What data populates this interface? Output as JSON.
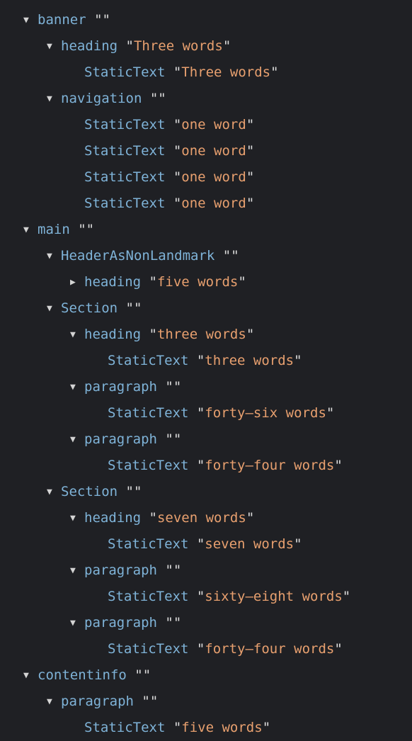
{
  "panel": {
    "name": "accessibility-tree",
    "theme": {
      "background": "#1f2024",
      "role_color": "#7fb3d8",
      "value_color": "#e8a06f",
      "quote_color": "#dcdcdc",
      "twisty_color": "#d4d4d4"
    },
    "icons": {
      "expanded": "▼",
      "collapsed": "▶"
    },
    "empty_value": ""
  },
  "tree": {
    "rows": [
      {
        "depth": 2,
        "twisty": "none",
        "role": "StaticText",
        "value": "one word",
        "clipped": true
      },
      {
        "depth": 0,
        "twisty": "expanded",
        "role": "banner",
        "value": ""
      },
      {
        "depth": 1,
        "twisty": "expanded",
        "role": "heading",
        "value": "Three words"
      },
      {
        "depth": 2,
        "twisty": "none",
        "role": "StaticText",
        "value": "Three words"
      },
      {
        "depth": 1,
        "twisty": "expanded",
        "role": "navigation",
        "value": ""
      },
      {
        "depth": 2,
        "twisty": "none",
        "role": "StaticText",
        "value": "one word"
      },
      {
        "depth": 2,
        "twisty": "none",
        "role": "StaticText",
        "value": "one word"
      },
      {
        "depth": 2,
        "twisty": "none",
        "role": "StaticText",
        "value": "one word"
      },
      {
        "depth": 2,
        "twisty": "none",
        "role": "StaticText",
        "value": "one word"
      },
      {
        "depth": 0,
        "twisty": "expanded",
        "role": "main",
        "value": ""
      },
      {
        "depth": 1,
        "twisty": "expanded",
        "role": "HeaderAsNonLandmark",
        "value": ""
      },
      {
        "depth": 2,
        "twisty": "collapsed",
        "role": "heading",
        "value": "five words"
      },
      {
        "depth": 1,
        "twisty": "expanded",
        "role": "Section",
        "value": ""
      },
      {
        "depth": 2,
        "twisty": "expanded",
        "role": "heading",
        "value": "three words"
      },
      {
        "depth": 3,
        "twisty": "none",
        "role": "StaticText",
        "value": "three words"
      },
      {
        "depth": 2,
        "twisty": "expanded",
        "role": "paragraph",
        "value": ""
      },
      {
        "depth": 3,
        "twisty": "none",
        "role": "StaticText",
        "value": "forty–six words"
      },
      {
        "depth": 2,
        "twisty": "expanded",
        "role": "paragraph",
        "value": ""
      },
      {
        "depth": 3,
        "twisty": "none",
        "role": "StaticText",
        "value": "forty–four words"
      },
      {
        "depth": 1,
        "twisty": "expanded",
        "role": "Section",
        "value": ""
      },
      {
        "depth": 2,
        "twisty": "expanded",
        "role": "heading",
        "value": "seven words"
      },
      {
        "depth": 3,
        "twisty": "none",
        "role": "StaticText",
        "value": "seven words"
      },
      {
        "depth": 2,
        "twisty": "expanded",
        "role": "paragraph",
        "value": ""
      },
      {
        "depth": 3,
        "twisty": "none",
        "role": "StaticText",
        "value": "sixty–eight words"
      },
      {
        "depth": 2,
        "twisty": "expanded",
        "role": "paragraph",
        "value": ""
      },
      {
        "depth": 3,
        "twisty": "none",
        "role": "StaticText",
        "value": "forty–four words"
      },
      {
        "depth": 0,
        "twisty": "expanded",
        "role": "contentinfo",
        "value": ""
      },
      {
        "depth": 1,
        "twisty": "expanded",
        "role": "paragraph",
        "value": ""
      },
      {
        "depth": 2,
        "twisty": "none",
        "role": "StaticText",
        "value": "five words"
      }
    ]
  }
}
